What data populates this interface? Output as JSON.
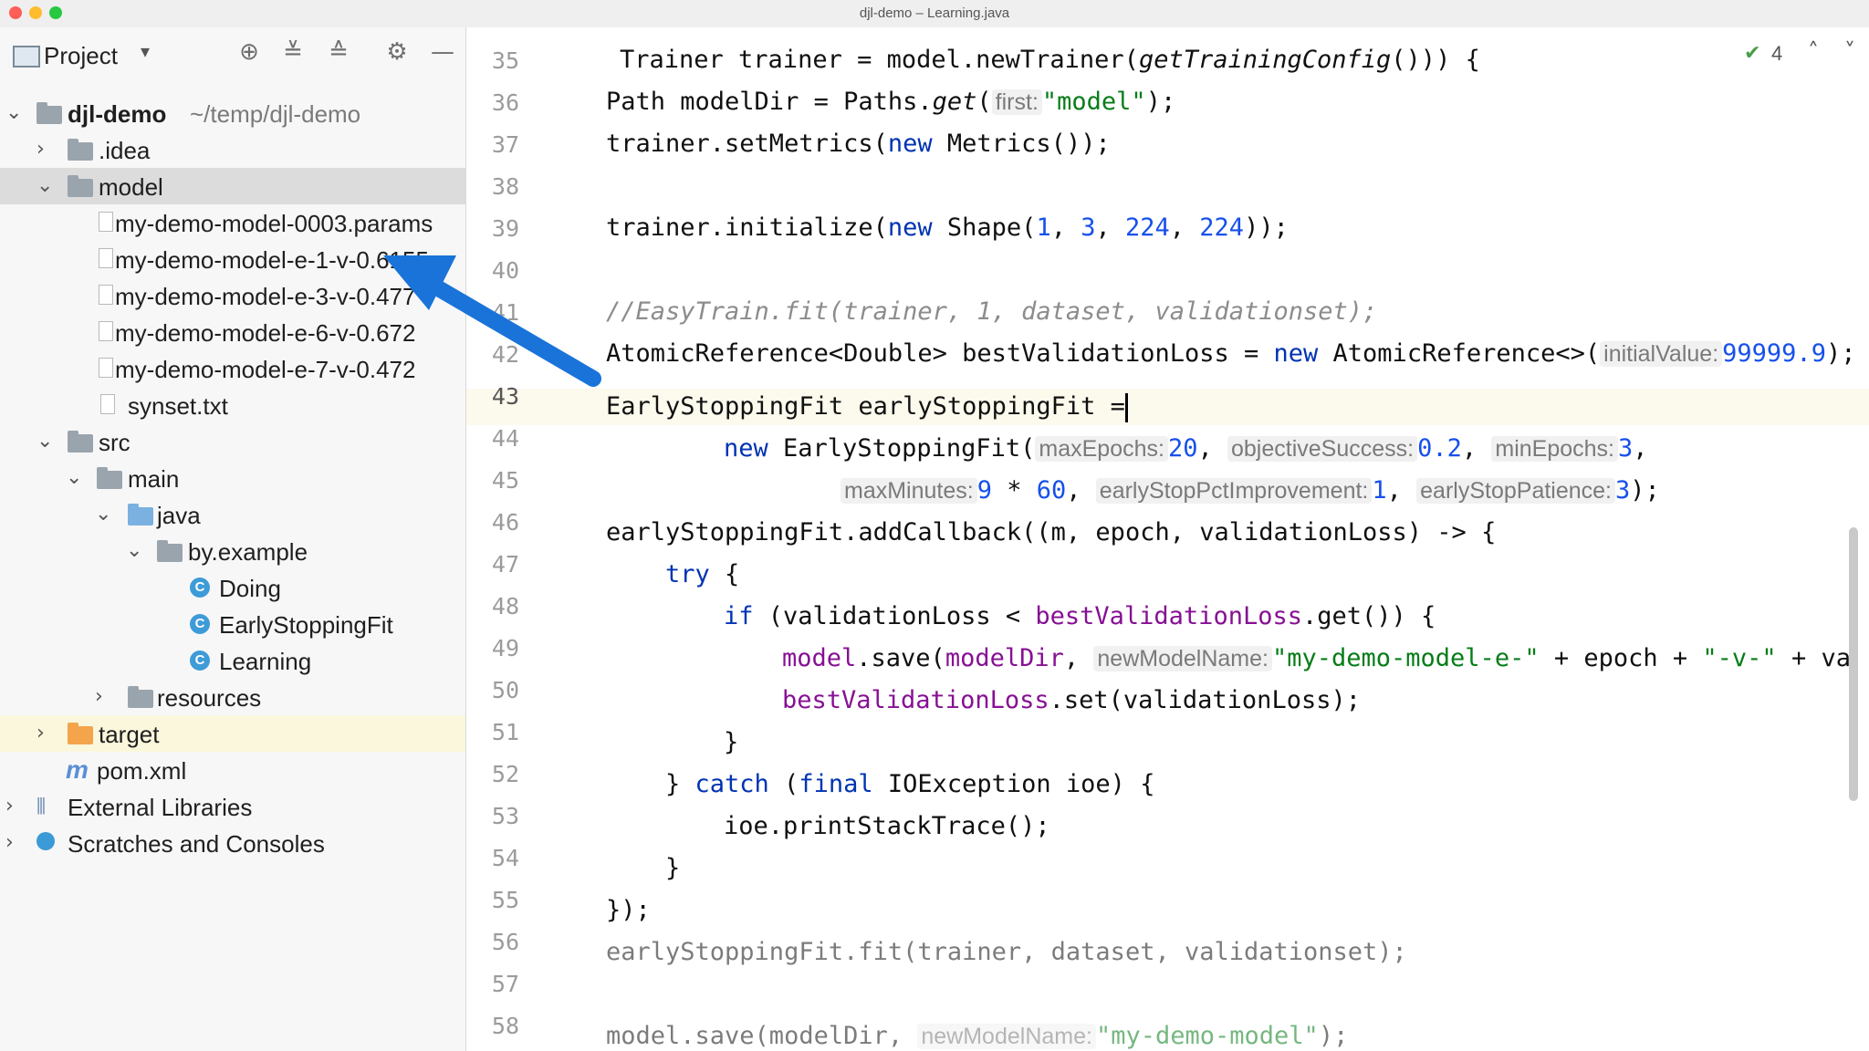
{
  "window": {
    "title": "djl-demo – Learning.java"
  },
  "sidebar": {
    "header": {
      "label": "Project"
    },
    "tree": [
      {
        "label": "djl-demo",
        "suffix": "~/temp/djl-demo"
      },
      {
        "label": ".idea"
      },
      {
        "label": "model"
      },
      {
        "label": "my-demo-model-0003.params"
      },
      {
        "label": "my-demo-model-e-1-v-0.6155"
      },
      {
        "label": "my-demo-model-e-3-v-0.477"
      },
      {
        "label": "my-demo-model-e-6-v-0.672"
      },
      {
        "label": "my-demo-model-e-7-v-0.472"
      },
      {
        "label": "synset.txt"
      },
      {
        "label": "src"
      },
      {
        "label": "main"
      },
      {
        "label": "java"
      },
      {
        "label": "by.example"
      },
      {
        "label": "Doing"
      },
      {
        "label": "EarlyStoppingFit"
      },
      {
        "label": "Learning"
      },
      {
        "label": "resources"
      },
      {
        "label": "target"
      },
      {
        "label": "pom.xml"
      },
      {
        "label": "External Libraries"
      },
      {
        "label": "Scratches and Consoles"
      }
    ]
  },
  "editor": {
    "inspection_count": "4",
    "line_numbers": [
      "35",
      "36",
      "37",
      "38",
      "39",
      "40",
      "41",
      "42",
      "43",
      "44",
      "45",
      "46",
      "47",
      "48",
      "49",
      "50",
      "51",
      "52",
      "53",
      "54",
      "55",
      "56",
      "57",
      "58"
    ],
    "tokens": {
      "l35": [
        "Trainer trainer = model.newTrainer(",
        "getTrainingConfig",
        "())) {"
      ],
      "l36": [
        "Path modelDir = Paths.",
        "get",
        "(",
        "first:",
        "\"model\"",
        ");"
      ],
      "l37": [
        "trainer.setMetrics(",
        "new",
        " Metrics());"
      ],
      "l39": [
        "trainer.initialize(",
        "new",
        " Shape(",
        "1",
        ", ",
        "3",
        ", ",
        "224",
        ", ",
        "224",
        "));"
      ],
      "l41": [
        "//EasyTrain.fit(trainer, 1, dataset, validationset);"
      ],
      "l42": [
        "AtomicReference<Double> bestValidationLoss = ",
        "new",
        " AtomicReference<>(",
        "initialValue:",
        "99999.9",
        ");"
      ],
      "l43": [
        "EarlyStoppingFit earlyStoppingFit ="
      ],
      "l44": [
        "new",
        " EarlyStoppingFit(",
        "maxEpochs:",
        "20",
        ", ",
        "objectiveSuccess:",
        "0.2",
        ", ",
        "minEpochs:",
        "3",
        ","
      ],
      "l45": [
        "maxMinutes:",
        "9",
        " * ",
        "60",
        ", ",
        "earlyStopPctImprovement:",
        "1",
        ", ",
        "earlyStopPatience:",
        "3",
        ");"
      ],
      "l46": [
        "earlyStoppingFit.addCallback((m, epoch, validationLoss) -> {"
      ],
      "l47": [
        "try",
        " {"
      ],
      "l48": [
        "if",
        " (validationLoss < ",
        "bestValidationLoss",
        ".get()) {"
      ],
      "l49": [
        "model",
        ".save(",
        "modelDir",
        ", ",
        "newModelName:",
        "\"my-demo-model-e-\"",
        " + epoch + ",
        "\"-v-\"",
        " + va"
      ],
      "l50": [
        "bestValidationLoss",
        ".set(validationLoss);"
      ],
      "l51": [
        "}"
      ],
      "l52": [
        "} ",
        "catch",
        " (",
        "final",
        " IOException ioe) {"
      ],
      "l53": [
        "ioe.printStackTrace();"
      ],
      "l54": [
        "}"
      ],
      "l55": [
        "});"
      ],
      "l56": [
        "earlyStoppingFit.fit(trainer, dataset, validationset);"
      ],
      "l58": [
        "model.save(modelDir, ",
        "newModelName:",
        "\"my-demo-model\"",
        ");"
      ]
    }
  },
  "colors": {
    "keyword": "#0033b3",
    "number": "#1750eb",
    "string": "#067d17",
    "field": "#871094",
    "arrow": "#1a73d9"
  }
}
